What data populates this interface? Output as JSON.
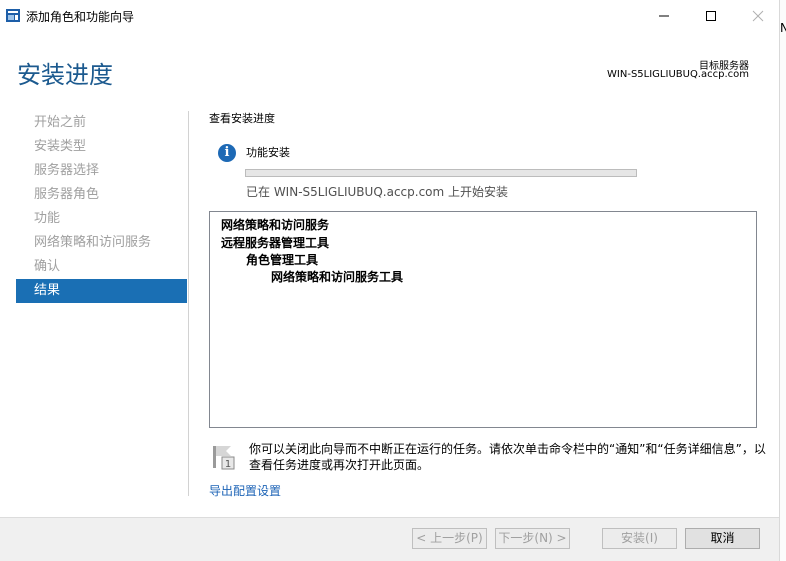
{
  "window": {
    "title": "添加角色和功能向导",
    "edge_letter": "N"
  },
  "header": {
    "page_title": "安装进度",
    "target_label": "目标服务器",
    "target_server": "WIN-S5LIGLIUBUQ.accp.com"
  },
  "nav": {
    "items": [
      {
        "label": "开始之前"
      },
      {
        "label": "安装类型"
      },
      {
        "label": "服务器选择"
      },
      {
        "label": "服务器角色"
      },
      {
        "label": "功能"
      },
      {
        "label": "网络策略和访问服务"
      },
      {
        "label": "确认"
      },
      {
        "label": "结果"
      }
    ],
    "active_index": 7
  },
  "main": {
    "heading": "查看安装进度",
    "feature_label": "功能安装",
    "progress_fraction": 0.0,
    "status": "已在 WIN-S5LIGLIUBUQ.accp.com 上开始安装",
    "results": [
      {
        "label": "网络策略和访问服务"
      },
      {
        "label": "远程服务器管理工具"
      },
      {
        "label": "角色管理工具"
      },
      {
        "label": "网络策略和访问服务工具"
      }
    ],
    "note_line1": "你可以关闭此向导而不中断正在运行的任务。请依次单击命令栏中的“通知”和“任务详细信息”，以",
    "note_line2": "查看任务进度或再次打开此页面。",
    "note_badge": "1",
    "export_link": "导出配置设置"
  },
  "buttons": {
    "prev": "< 上一步(P)",
    "next": "下一步(N) >",
    "install": "安装(I)",
    "cancel": "取消"
  },
  "colors": {
    "title_blue": "#1c5a8f",
    "nav_active": "#1a6fb4",
    "link": "#1c63b6"
  }
}
